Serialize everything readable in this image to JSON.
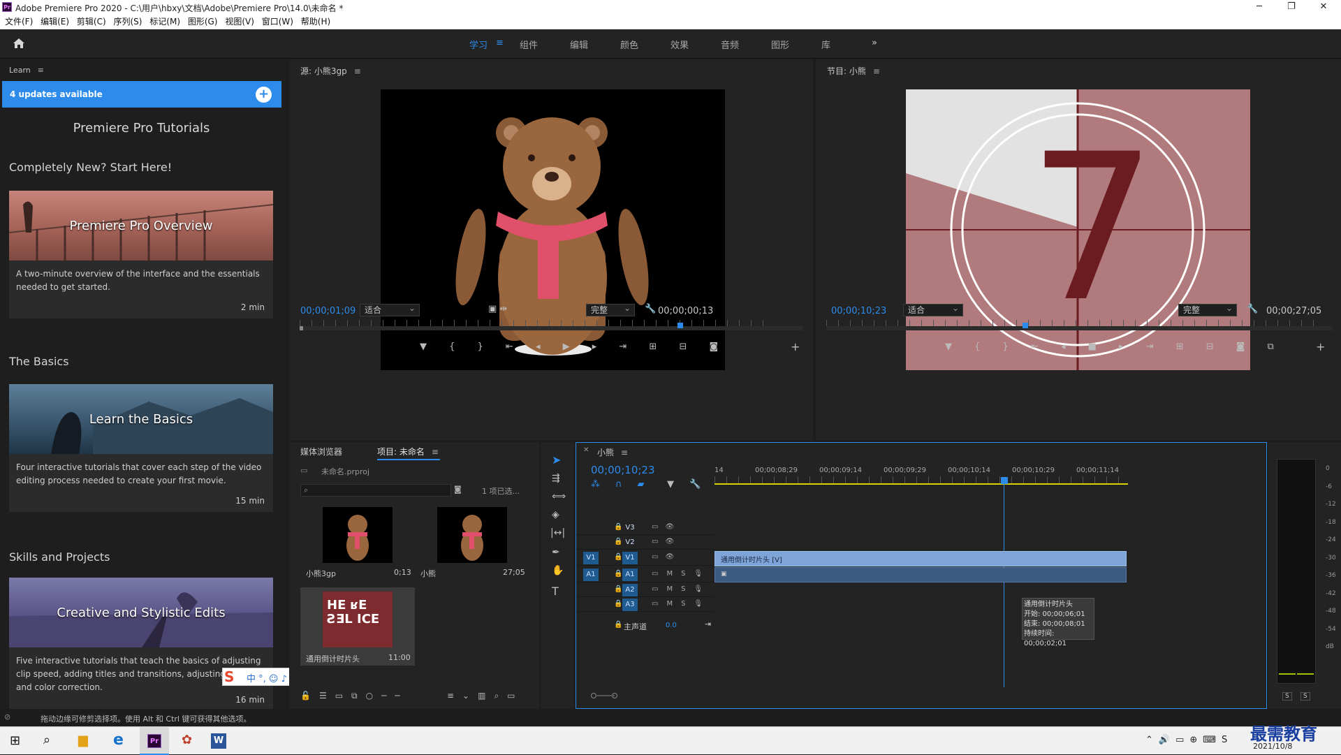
{
  "window": {
    "title": "Adobe Premiere Pro 2020 - C:\\用户\\hbxy\\文档\\Adobe\\Premiere Pro\\14.0\\未命名 *",
    "minimize": "─",
    "maximize": "❐",
    "close": "✕"
  },
  "menu": [
    "文件(F)",
    "编辑(E)",
    "剪辑(C)",
    "序列(S)",
    "标记(M)",
    "图形(G)",
    "视图(V)",
    "窗口(W)",
    "帮助(H)"
  ],
  "workspaces": {
    "tabs": [
      "学习",
      "组件",
      "编辑",
      "颜色",
      "效果",
      "音频",
      "图形",
      "库"
    ],
    "active": "学习",
    "more": "»"
  },
  "learn": {
    "panel_title": "Learn",
    "updates": "4 updates available",
    "header": "Premiere Pro Tutorials",
    "sections": [
      {
        "title": "Completely New? Start Here!",
        "card_title": "Premiere Pro Overview",
        "desc": "A two-minute overview of the interface and the essentials needed to get started.",
        "duration": "2 min"
      },
      {
        "title": "The Basics",
        "card_title": "Learn the Basics",
        "desc": "Four interactive tutorials that cover each step of the video editing process needed to create your first movie.",
        "duration": "15 min"
      },
      {
        "title": "Skills and Projects",
        "card_title": "Creative and Stylistic Edits",
        "desc": "Five interactive tutorials that teach the basics of adjusting clip speed, adding titles and transitions, adjusting audio, and color correction.",
        "duration": "16 min"
      }
    ]
  },
  "source": {
    "title": "源: 小熊3gp",
    "timecode": "00;00;01;09",
    "fit": "适合",
    "quality": "完整",
    "duration": "00;00;00;13"
  },
  "program": {
    "title": "节目: 小熊",
    "timecode": "00;00;10;23",
    "fit": "适合",
    "quality": "完整",
    "duration": "00;00;27;05",
    "countdown": "7"
  },
  "project": {
    "tabs": [
      "媒体浏览器",
      "项目: 未命名"
    ],
    "file": "未命名.prproj",
    "selection": "1 项已选...",
    "search_placeholder": "",
    "items": [
      {
        "name": "小熊3gp",
        "duration": "0;13"
      },
      {
        "name": "小熊",
        "duration": "27;05"
      },
      {
        "name": "通用倒计时片头",
        "duration": "11:00"
      }
    ],
    "leader_text": "HE ʁE\nƧƎL ICE"
  },
  "timeline": {
    "tab": "小熊",
    "timecode": "00;00;10;23",
    "ruler": [
      "14",
      "00;00;08;29",
      "00;00;09;14",
      "00;00;09;29",
      "00;00;10;14",
      "00;00;10;29",
      "00;00;11;14"
    ],
    "video_tracks": [
      "V3",
      "V2",
      "V1"
    ],
    "audio_tracks": [
      "A1",
      "A2",
      "A3"
    ],
    "source_v": "V1",
    "source_a": "A1",
    "master": "主声道",
    "master_value": "0.0",
    "clip_name": "通用倒计时片头 [V]",
    "tooltip": {
      "name": "通用倒计时片头",
      "start": "开始: 00;00;06;01",
      "end": "结束: 00;00;08;01",
      "duration": "持续时间: 00;00;02;01"
    }
  },
  "meter": {
    "scale": [
      "0",
      "-6",
      "-12",
      "-18",
      "-24",
      "-30",
      "-36",
      "-42",
      "-48",
      "-54",
      "dB"
    ],
    "solo": [
      "S",
      "S"
    ]
  },
  "status": "拖动边缘可修剪选择项。使用 Alt 和 Ctrl 键可获得其他选项。",
  "taskbar": {
    "date": "2021/10/8",
    "watermark": "最需教育"
  }
}
